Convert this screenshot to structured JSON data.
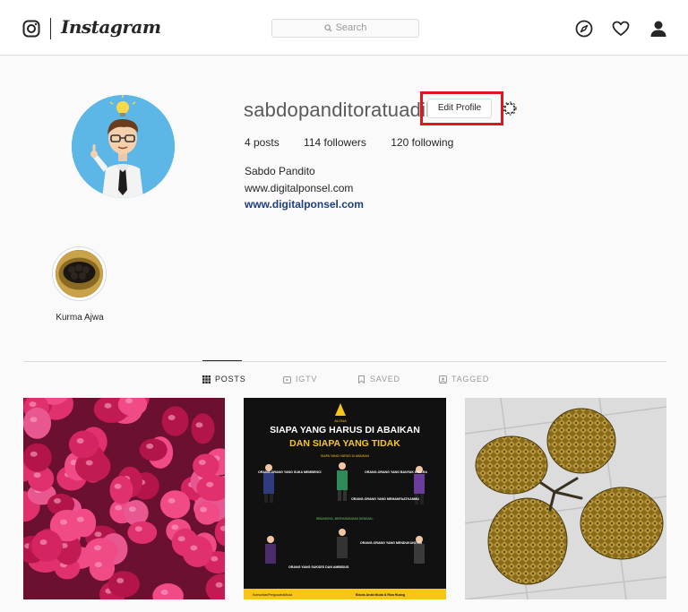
{
  "header": {
    "brand": "Instagram",
    "search_placeholder": "Search",
    "icons": [
      "instagram-glyph-icon",
      "explore-compass-icon",
      "activity-heart-icon",
      "profile-person-icon"
    ]
  },
  "profile": {
    "username": "sabdopanditoratuadil",
    "edit_profile_label": "Edit Profile",
    "posts": "4 posts",
    "followers": "114 followers",
    "following": "120 following",
    "full_name": "Sabdo Pandito",
    "bio": "www.digitalponsel.com",
    "website": "www.digitalponsel.com"
  },
  "highlights": [
    {
      "label": "Kurma Ajwa"
    }
  ],
  "tabs": [
    {
      "label": "POSTS",
      "icon": "grid-icon",
      "active": true
    },
    {
      "label": "IGTV",
      "icon": "igtv-icon",
      "active": false
    },
    {
      "label": "SAVED",
      "icon": "bookmark-icon",
      "active": false
    },
    {
      "label": "TAGGED",
      "icon": "tagged-icon",
      "active": false
    }
  ],
  "posts": {
    "poster": {
      "logo_text": "ALONA",
      "title_line1": "SIAPA YANG HARUS DI ABAIKAN",
      "title_line2": "DAN SIAPA YANG TIDAK",
      "subtitle": "SIAPA YANG HARUS DI ABAIKAN",
      "label_a": "ORANG-ORANG YANG SUKA MEMBENCI",
      "label_b": "ORANG-ORANG YANG BANYAK BICARA",
      "label_c": "ORANG-ORANG YANG MEMANFAATKANMU",
      "middle_note": "SEBAIKNYA, BERHUBUNGAN DENGAN :",
      "label_d": "ORANG-ORANG YANG MENDUKUNGMU",
      "label_e": "ORANG YANG SUKSES DAN AMBISIUS",
      "footer_left": "KomunitasPengusahaMuda",
      "footer_right": "Bisnis Anak Muda & Riza Huang"
    }
  },
  "colors": {
    "highlight_box": "#e0161b",
    "link": "#1e3f7d",
    "poster_yellow": "#f5c518",
    "poster_bg": "#111111"
  }
}
